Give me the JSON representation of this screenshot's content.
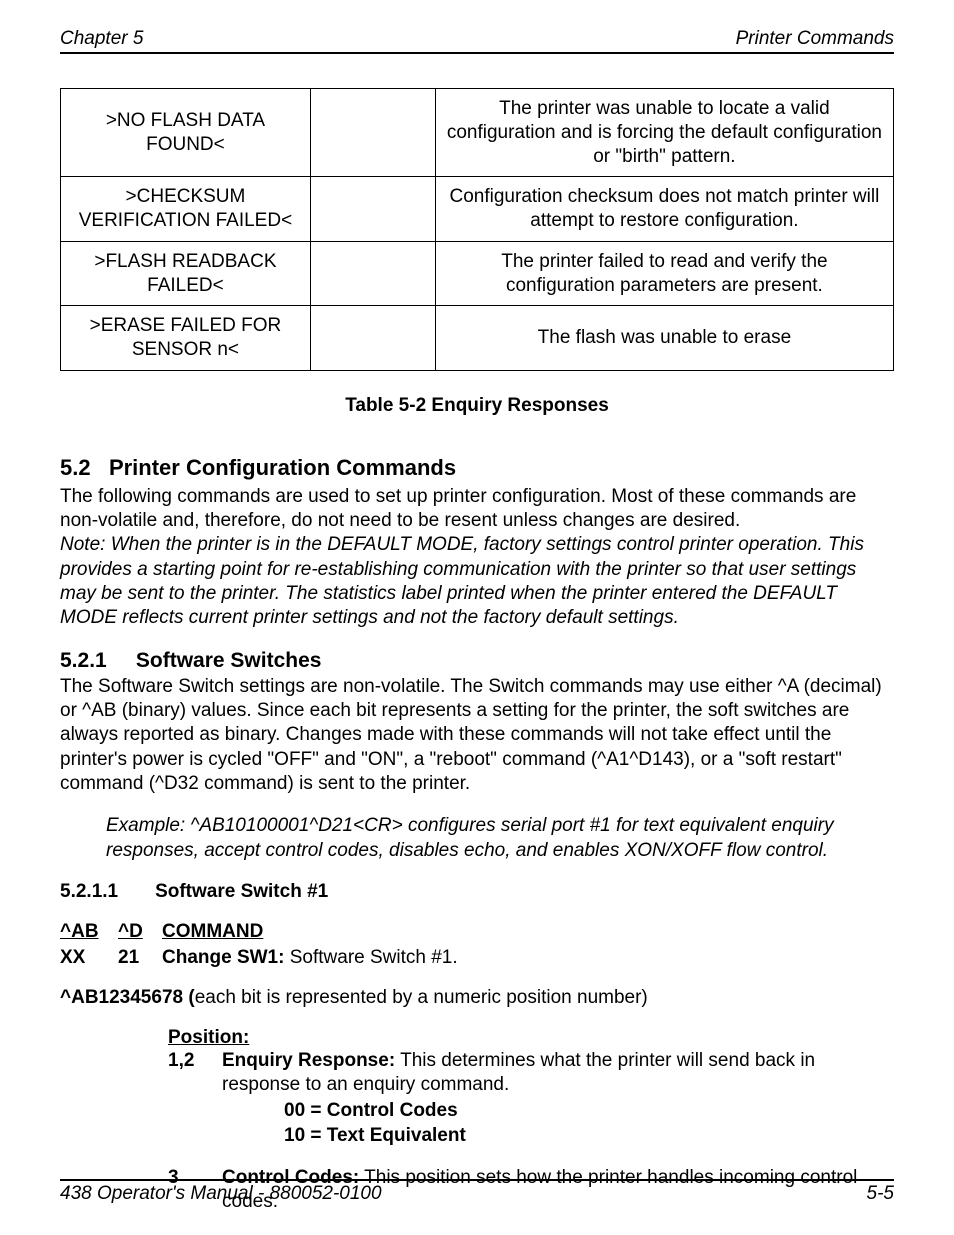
{
  "header": {
    "left": "Chapter 5",
    "right": "Printer Commands"
  },
  "table": {
    "rows": [
      {
        "c1": ">NO FLASH DATA FOUND<",
        "c2": "",
        "c3": "The printer was unable to locate a valid configuration and is forcing the default configuration or \"birth\" pattern."
      },
      {
        "c1": ">CHECKSUM VERIFICATION FAILED<",
        "c2": "",
        "c3": "Configuration checksum does not match printer will attempt to restore configuration."
      },
      {
        "c1": ">FLASH READBACK FAILED<",
        "c2": "",
        "c3": "The printer failed to read and verify the configuration parameters are present."
      },
      {
        "c1": ">ERASE FAILED FOR SENSOR n<",
        "c2": "",
        "c3": "The flash was unable to erase"
      }
    ],
    "caption": "Table 5-2    Enquiry Responses"
  },
  "sec52": {
    "num": "5.2",
    "title": "Printer Configuration Commands",
    "p1": "The following commands are used to set up printer configuration.  Most of these commands are non-volatile and, therefore, do not need to be resent unless changes are desired.",
    "note": "Note:  When the printer is in the DEFAULT MODE, factory settings control printer operation. This provides a starting point for re-establishing communication with the printer so that user settings may be sent to the printer.  The statistics label printed when the printer entered the DEFAULT MODE reflects current printer settings and not the factory default settings."
  },
  "sec521": {
    "num": "5.2.1",
    "title": "Software Switches",
    "p1": "The Software Switch settings are non-volatile.  The Switch commands may use either ^A (decimal) or ^AB (binary) values.  Since each bit represents a setting for the printer, the soft switches are always reported as binary.  Changes made with these commands will not take effect until the printer's power is cycled \"OFF\" and \"ON\", a \"reboot\" command (^A1^D143), or a \"soft restart\" command (^D32 command) is sent to the printer.",
    "example": "Example:  ^AB10100001^D21<CR> configures serial port #1 for text equivalent enquiry responses, accept control codes, disables echo, and enables XON/XOFF flow control."
  },
  "sec5211": {
    "num": "5.2.1.1",
    "title": "Software Switch #1",
    "cmd": {
      "h1": "^AB",
      "h2": "^D",
      "h3": "COMMAND",
      "v1": "XX",
      "v2": "21",
      "v3_bold": "Change SW1:",
      "v3_rest": " Software Switch #1."
    },
    "bits_bold": "^AB12345678 (",
    "bits_rest": "each bit is represented by a numeric position number)",
    "pos_heading": "Position:",
    "positions": [
      {
        "num": "1,2",
        "label": "Enquiry Response:",
        "text": " This determines what the printer will send back in response to an enquiry command.",
        "values": [
          "00 = Control Codes",
          "10 = Text Equivalent"
        ]
      },
      {
        "num": "3",
        "label": "Control Codes:",
        "text": " This position sets how the printer handles incoming control codes.",
        "values": []
      }
    ]
  },
  "footer": {
    "left": "438 Operator's Manual - 880052-0100",
    "right": "5-5"
  }
}
